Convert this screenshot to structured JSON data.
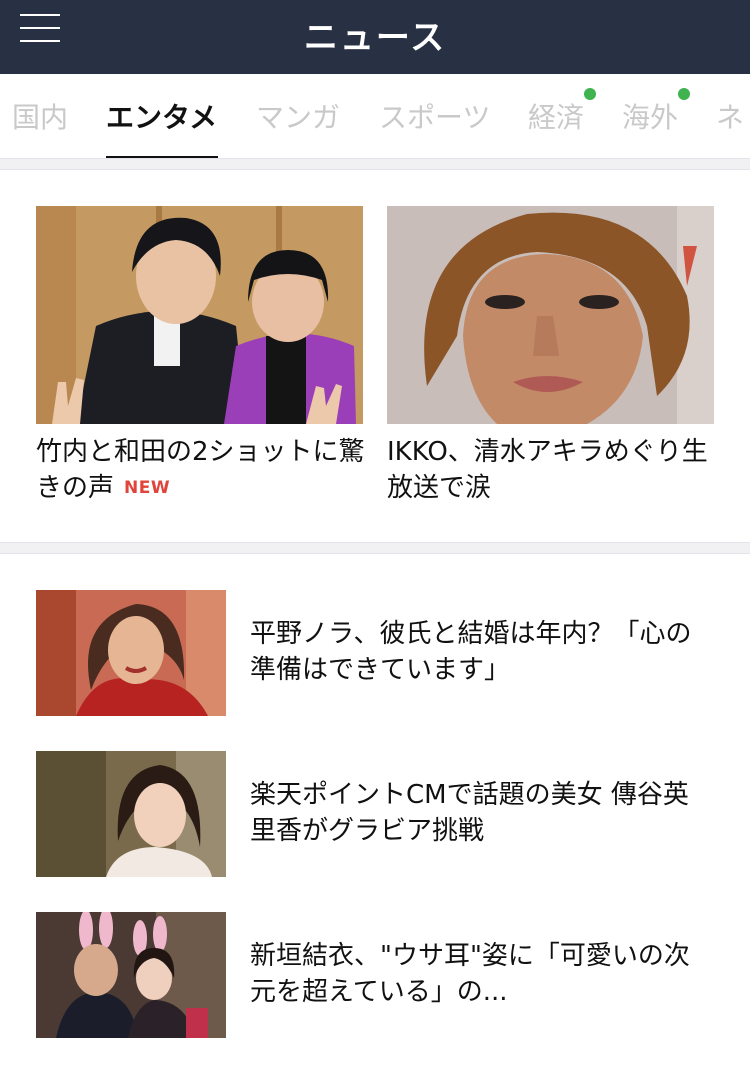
{
  "header": {
    "title": "ニュース"
  },
  "tabs": [
    {
      "label": "国内",
      "active": false,
      "dot": false
    },
    {
      "label": "エンタメ",
      "active": true,
      "dot": false
    },
    {
      "label": "マンガ",
      "active": false,
      "dot": false
    },
    {
      "label": "スポーツ",
      "active": false,
      "dot": false
    },
    {
      "label": "経済",
      "active": false,
      "dot": true
    },
    {
      "label": "海外",
      "active": false,
      "dot": true
    },
    {
      "label": "ネ",
      "active": false,
      "dot": false
    }
  ],
  "colors": {
    "header_bg": "#283044",
    "new_badge": "#e0443b",
    "dot": "#3fb34f"
  },
  "featured": [
    {
      "title": "竹内と和田の2ショットに驚きの声",
      "badge": "NEW"
    },
    {
      "title": "IKKO、清水アキラめぐり生放送で涙",
      "badge": ""
    }
  ],
  "articles": [
    {
      "title": "平野ノラ、彼氏と結婚は年内？「心の準備はできています」"
    },
    {
      "title": "楽天ポイントCMで話題の美女 傳谷英里香がグラビア挑戦"
    },
    {
      "title": "新垣結衣、\"ウサ耳\"姿に「可愛いの次元を超えている」の..."
    }
  ]
}
